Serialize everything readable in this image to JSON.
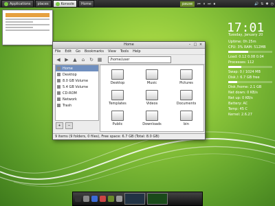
{
  "taskbar": {
    "tasks": [
      {
        "label": "Applications",
        "active": false
      },
      {
        "label": "places",
        "active": false
      },
      {
        "label": "Konsole",
        "active": true
      },
      {
        "label": "Home",
        "active": false
      }
    ],
    "player_controls": [
      "prev-icon",
      "pause-icon",
      "next-icon",
      "stop-icon"
    ],
    "title_chip": "pause",
    "tray": [
      "volume-icon",
      "network-icon",
      "bluetooth-icon",
      "clock-icon"
    ]
  },
  "file_manager": {
    "title": "Home",
    "menu": [
      "File",
      "Edit",
      "Go",
      "Bookmarks",
      "View",
      "Tools",
      "Help"
    ],
    "location": "/home/user",
    "sidebar": [
      {
        "label": "Home",
        "selected": true
      },
      {
        "label": "Desktop",
        "selected": false
      },
      {
        "label": "8.0 GB Volume",
        "selected": false
      },
      {
        "label": "5.4 GB Volume",
        "selected": false
      },
      {
        "label": "CD-ROM",
        "selected": false
      },
      {
        "label": "Network",
        "selected": false
      },
      {
        "label": "Trash",
        "selected": false
      }
    ],
    "folders": [
      "Desktop",
      "Music",
      "Pictures",
      "Templates",
      "Videos",
      "Documents",
      "Public",
      "Downloads",
      "bin"
    ],
    "status": "9 items (9 folders, 0 files), Free space: 6.7 GB (Total: 8.0 GB)"
  },
  "monitor": {
    "time": "17:01",
    "date": "Tuesday, January 20",
    "lines": [
      "Uptime: 0h 25m",
      "CPU: 3%  RAM: 512MB",
      "Load: 0.12 0.08 0.04",
      "Processes: 112",
      "Swap: 0 / 1024 MB",
      "Disk /: 6.7 GB free",
      "Disk /home: 2.1 GB",
      "Net down: 0 KB/s",
      "Net up: 0 KB/s",
      "Battery: AC",
      "Temp: 45 C",
      "Kernel: 2.6.27"
    ],
    "bars": [
      0.1,
      0.45,
      0.7,
      0.3,
      0.55,
      0.2
    ]
  },
  "dock": {
    "icons": [
      "terminal-icon",
      "home-icon",
      "browser-icon",
      "mail-icon",
      "music-icon",
      "settings-icon"
    ],
    "colors": [
      "#333333",
      "#888888",
      "#3b6bd6",
      "#cc4444",
      "#6a8a2a",
      "#999999"
    ]
  }
}
